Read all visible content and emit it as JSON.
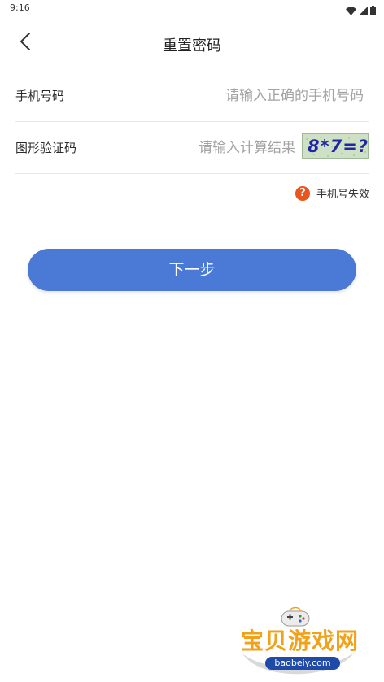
{
  "status_bar": {
    "time": "9:16"
  },
  "nav": {
    "title": "重置密码",
    "back_icon": "chevron-left-icon"
  },
  "form": {
    "phone": {
      "label": "手机号码",
      "value": "",
      "placeholder": "请输入正确的手机号码"
    },
    "captcha": {
      "label": "图形验证码",
      "value": "",
      "placeholder": "请输入计算结果",
      "image_text": "8*7=?"
    }
  },
  "links": {
    "phone_invalid": "手机号失效",
    "help_icon": "question-circle-icon",
    "help_icon_color": "#e9541f"
  },
  "actions": {
    "next_label": "下一步",
    "next_color": "#4a7ad6"
  },
  "watermark": {
    "title": "宝贝游戏网",
    "url": "baobeiy.com"
  }
}
